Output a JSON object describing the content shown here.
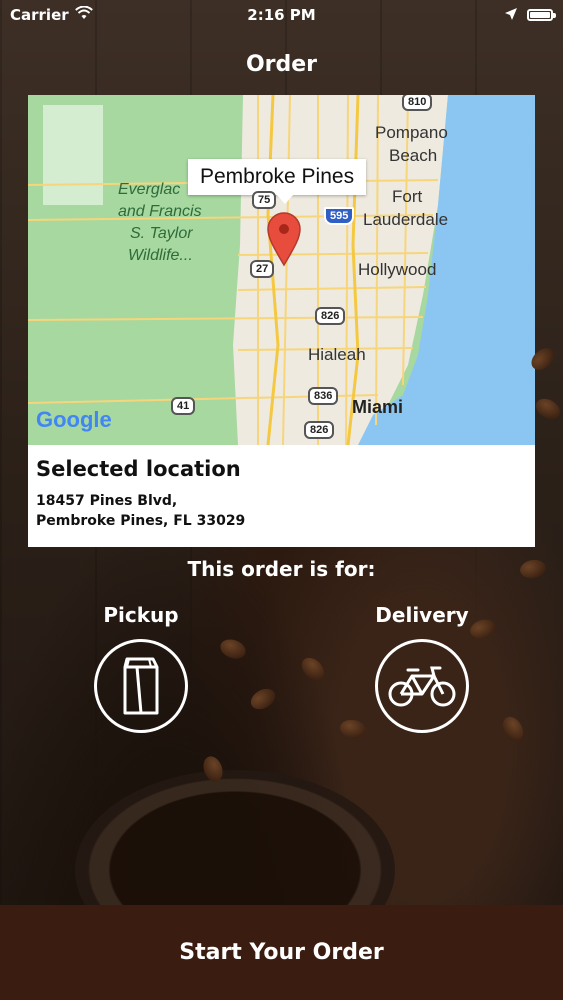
{
  "status_bar": {
    "carrier": "Carrier",
    "time": "2:16 PM"
  },
  "nav": {
    "title": "Order"
  },
  "map": {
    "callout": "Pembroke Pines",
    "labels": {
      "pompano": "Pompano",
      "beach": "Beach",
      "fort": "Fort",
      "lauderdale": "Lauderdale",
      "hollywood": "Hollywood",
      "hialeah": "Hialeah",
      "miami": "Miami",
      "park_line1": "Everglac",
      "park_line2": "and Francis",
      "park_line3": "S. Taylor",
      "park_line4": "Wildlife..."
    },
    "shields": {
      "s810": "810",
      "s595": "595",
      "s27": "27",
      "s826a": "826",
      "s836": "836",
      "s826b": "826",
      "s41": "41",
      "s75": "75"
    },
    "google": "Google",
    "colors": {
      "land": "#a6d8a0",
      "urban": "#eeeae0",
      "water": "#8bc6f2",
      "road": "#f7d57a",
      "pin": "#e74c3c"
    }
  },
  "location": {
    "heading": "Selected location",
    "address_line1": "18457 Pines Blvd,",
    "address_line2": "Pembroke Pines, FL 33029"
  },
  "order": {
    "prompt": "This order is for:",
    "pickup_label": "Pickup",
    "delivery_label": "Delivery"
  },
  "button": {
    "start": "Start Your Order",
    "color": "#3a1c10"
  }
}
